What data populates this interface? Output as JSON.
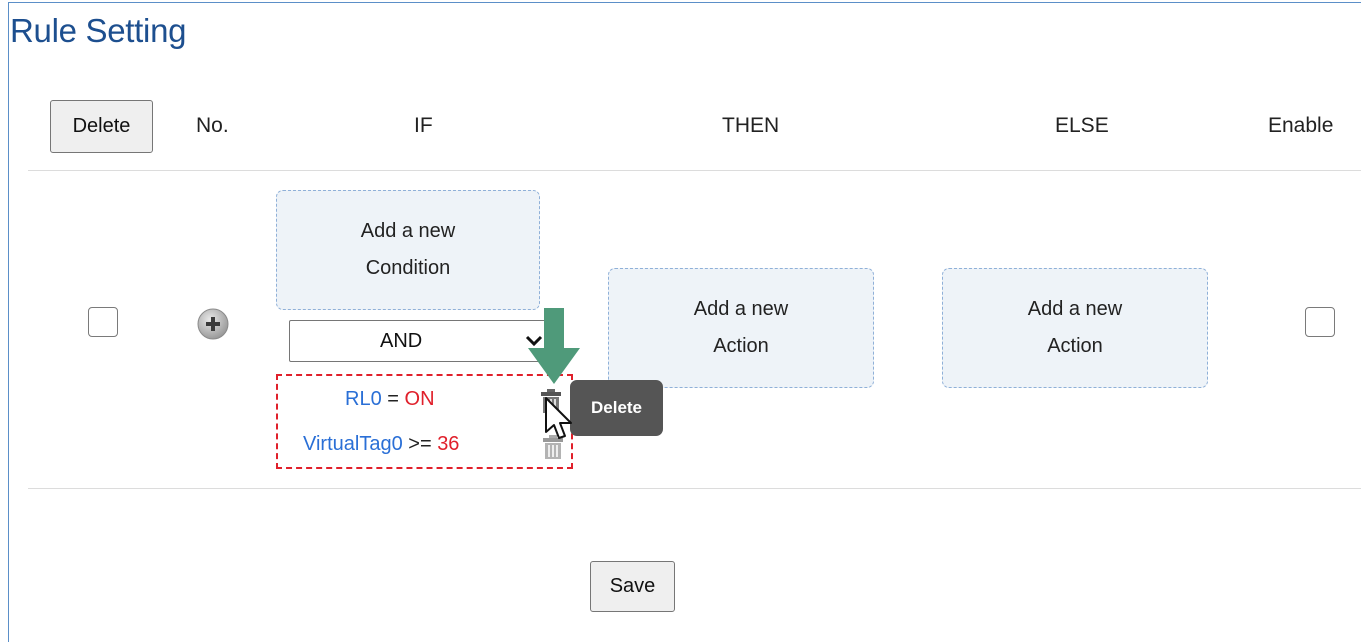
{
  "page": {
    "title": "Rule Setting"
  },
  "header": {
    "delete_label": "Delete",
    "col_no": "No.",
    "col_if": "IF",
    "col_then": "THEN",
    "col_else": "ELSE",
    "col_enable": "Enable"
  },
  "rule": {
    "if_add_line1": "Add a new",
    "if_add_line2": "Condition",
    "logic_selected": "AND",
    "conditions": [
      {
        "tag": "RL0",
        "operator": "=",
        "value": "ON"
      },
      {
        "tag": "VirtualTag0",
        "operator": ">=",
        "value": "36"
      }
    ],
    "then_add_line1": "Add a new",
    "then_add_line2": "Action",
    "else_add_line1": "Add a new",
    "else_add_line2": "Action"
  },
  "tooltip": {
    "text": "Delete"
  },
  "footer": {
    "save_label": "Save"
  },
  "icons": {
    "add_rule": "plus-circle-icon",
    "remove_condition": "trash-icon",
    "annotation_arrow": "arrow-down-icon",
    "cursor": "pointer-cursor-icon"
  },
  "colors": {
    "title": "#1d4f8f",
    "tag": "#2a6fd6",
    "value": "#e0202b",
    "highlight_border": "#e0202b",
    "tooltip_bg": "#555555",
    "arrow": "#4f9a7a"
  }
}
